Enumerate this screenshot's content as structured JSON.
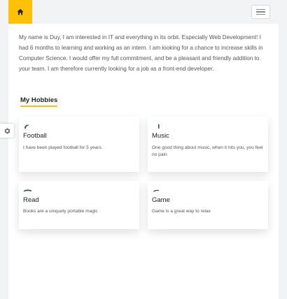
{
  "intro": {
    "text": "My name is Duy, I am interested in IT and everything in its orbit. Especially Web Development! I had 6 months to learning and working as an intern. I am looking for a chance to increase skills in Computer Science. I would offer my full commitment, and be a pleasant and friendly addition to your team. I am therefore currently looking for a job as a front-end developer."
  },
  "hobbies": {
    "title": "My Hobbies",
    "items": [
      {
        "name": "Football",
        "description": "I have been played football for 5 years.",
        "icon": "football-icon"
      },
      {
        "name": "Music",
        "description": "One good thing about music, when it hits you, you feel no pain",
        "icon": "music-icon"
      },
      {
        "name": "Read",
        "description": "Books are a uniquely portable magic",
        "icon": "book-icon"
      },
      {
        "name": "Game",
        "description": "Game is a great way to relax",
        "icon": "gamepad-icon"
      }
    ]
  },
  "colors": {
    "accent": "#ffc107",
    "icon_teal": "#2d5a56",
    "background": "#f2f3f5"
  },
  "icons": {
    "home": "home-icon",
    "menu": "hamburger-menu-icon",
    "settings": "gear-icon"
  }
}
